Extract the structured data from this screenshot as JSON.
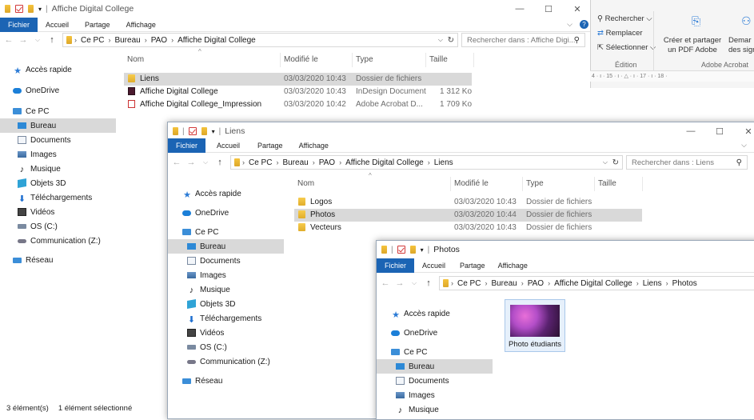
{
  "win1": {
    "title": "Affiche Digital College",
    "tabs": [
      "Fichier",
      "Accueil",
      "Partage",
      "Affichage"
    ],
    "path": [
      "Ce PC",
      "Bureau",
      "PAO",
      "Affiche Digital College"
    ],
    "search_placeholder": "Rechercher dans : Affiche Digi...",
    "columns": [
      "Nom",
      "Modifié le",
      "Type",
      "Taille"
    ],
    "files": [
      {
        "name": "Liens",
        "date": "03/03/2020 10:43",
        "type": "Dossier de fichiers",
        "size": "",
        "icon": "folder-icon"
      },
      {
        "name": "Affiche Digital College",
        "date": "03/03/2020 10:43",
        "type": "InDesign Document",
        "size": "1 312 Ko",
        "icon": "indesign-file-icon"
      },
      {
        "name": "Affiche Digital College_Impression",
        "date": "03/03/2020 10:42",
        "type": "Adobe Acrobat D...",
        "size": "1 709 Ko",
        "icon": "pdf-file-icon"
      }
    ],
    "status": {
      "count": "3 élément(s)",
      "selected": "1 élément sélectionné"
    }
  },
  "sidebar": {
    "quick": "Accès rapide",
    "onedrive": "OneDrive",
    "pc": "Ce PC",
    "items": [
      "Bureau",
      "Documents",
      "Images",
      "Musique",
      "Objets 3D",
      "Téléchargements",
      "Vidéos",
      "OS (C:)",
      "Communication (Z:)"
    ],
    "network": "Réseau"
  },
  "ribbon": {
    "find": "Rechercher",
    "replace": "Remplacer",
    "select": "Sélectionner",
    "edit_group": "Édition",
    "create_share": "Créer et partager",
    "pdf_adobe": "un PDF Adobe",
    "demand": "Demar",
    "signature": "des signa",
    "acrobat_group": "Adobe Acrobat",
    "ruler": "4 · ı · 15 · ı · △ · ı · 17 · ı · 18 ·"
  },
  "win2": {
    "title": "Liens",
    "tabs": [
      "Fichier",
      "Accueil",
      "Partage",
      "Affichage"
    ],
    "path": [
      "Ce PC",
      "Bureau",
      "PAO",
      "Affiche Digital College",
      "Liens"
    ],
    "search_placeholder": "Rechercher dans : Liens",
    "columns": [
      "Nom",
      "Modifié le",
      "Type",
      "Taille"
    ],
    "files": [
      {
        "name": "Logos",
        "date": "03/03/2020 10:43",
        "type": "Dossier de fichiers"
      },
      {
        "name": "Photos",
        "date": "03/03/2020 10:44",
        "type": "Dossier de fichiers"
      },
      {
        "name": "Vecteurs",
        "date": "03/03/2020 10:43",
        "type": "Dossier de fichiers"
      }
    ]
  },
  "win3": {
    "title": "Photos",
    "tabs": [
      "Fichier",
      "Accueil",
      "Partage",
      "Affichage"
    ],
    "path": [
      "Ce PC",
      "Bureau",
      "PAO",
      "Affiche Digital College",
      "Liens",
      "Photos"
    ],
    "photo": "Photo étudiants",
    "sidebar_items": [
      "Bureau",
      "Documents",
      "Images",
      "Musique"
    ]
  },
  "colors": {
    "accent": "#1b64b4",
    "selection": "#d9d9d9",
    "folder": "#f5c33c"
  }
}
